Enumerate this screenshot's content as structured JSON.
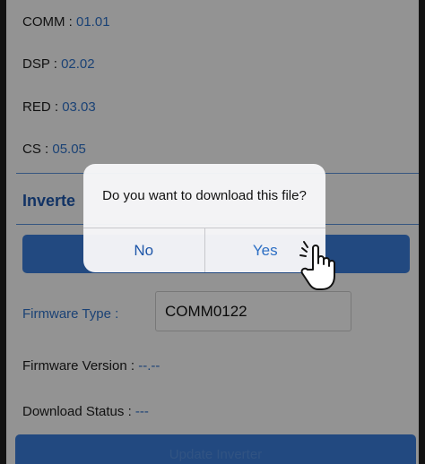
{
  "versions": [
    {
      "label": "COMM :",
      "value": "01.01"
    },
    {
      "label": "DSP :",
      "value": "02.02"
    },
    {
      "label": "RED :",
      "value": "03.03"
    },
    {
      "label": "CS :",
      "value": "05.05"
    }
  ],
  "inverter_section": {
    "title": "Inverte"
  },
  "firmware": {
    "type_label": "Firmware Type :",
    "type_value": "COMM0122",
    "version_label": "Firmware Version :",
    "version_value": "--.--",
    "status_label": "Download Status :",
    "status_value": "---"
  },
  "bottom_button": {
    "label": "Update Inverter"
  },
  "dialog": {
    "message": "Do you want to download this file?",
    "no_label": "No",
    "yes_label": "Yes"
  },
  "colors": {
    "accent": "#3a7bd5",
    "value_text": "#2d6fc4",
    "title_text": "#1e56a8",
    "overlay": "rgba(0,0,0,0.40)"
  },
  "icons": {
    "pointer": "tap-hand-icon"
  }
}
